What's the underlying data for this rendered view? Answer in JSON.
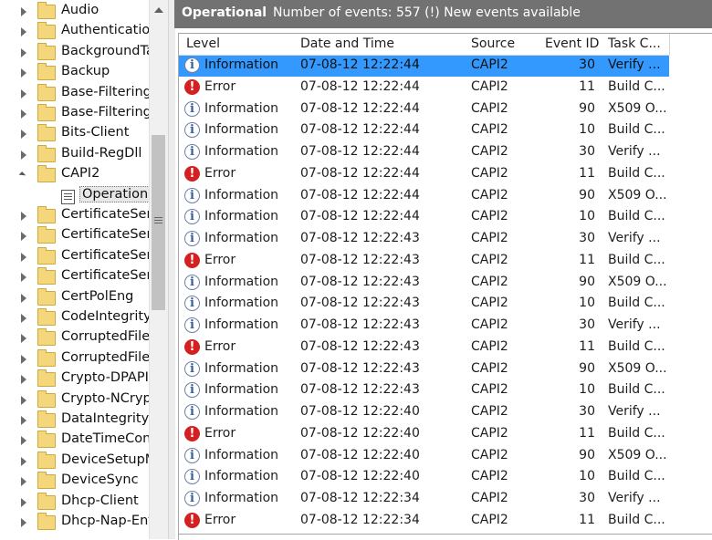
{
  "tree": {
    "items": [
      {
        "label": "Audio",
        "type": "folder"
      },
      {
        "label": "Authentication",
        "type": "folder"
      },
      {
        "label": "BackgroundTa",
        "type": "folder"
      },
      {
        "label": "Backup",
        "type": "folder"
      },
      {
        "label": "Base-Filtering-",
        "type": "folder"
      },
      {
        "label": "Base-Filtering-",
        "type": "folder"
      },
      {
        "label": "Bits-Client",
        "type": "folder"
      },
      {
        "label": "Build-RegDll",
        "type": "folder"
      },
      {
        "label": "CAPI2",
        "type": "folder",
        "expanded": true
      },
      {
        "label": "Operationa",
        "type": "log",
        "selected": true
      },
      {
        "label": "CertificateServ",
        "type": "folder"
      },
      {
        "label": "CertificateServ",
        "type": "folder"
      },
      {
        "label": "CertificateServ",
        "type": "folder"
      },
      {
        "label": "CertificateServ",
        "type": "folder"
      },
      {
        "label": "CertPolEng",
        "type": "folder"
      },
      {
        "label": "CodeIntegrity",
        "type": "folder"
      },
      {
        "label": "CorruptedFileR",
        "type": "folder"
      },
      {
        "label": "CorruptedFileF",
        "type": "folder"
      },
      {
        "label": "Crypto-DPAPI",
        "type": "folder"
      },
      {
        "label": "Crypto-NCrypt",
        "type": "folder"
      },
      {
        "label": "DataIntegritySc",
        "type": "folder"
      },
      {
        "label": "DateTimeCont",
        "type": "folder"
      },
      {
        "label": "DeviceSetupM",
        "type": "folder"
      },
      {
        "label": "DeviceSync",
        "type": "folder"
      },
      {
        "label": "Dhcp-Client",
        "type": "folder"
      },
      {
        "label": "Dhcp-Nap-Enf",
        "type": "folder"
      }
    ]
  },
  "header": {
    "title": "Operational",
    "count": "Number of events: 557 (!) New events available"
  },
  "grid": {
    "columns": [
      "Level",
      "Date and Time",
      "Source",
      "Event ID",
      "Task C..."
    ],
    "rows": [
      {
        "level": "Information",
        "date": "07-08-12 12:22:44",
        "source": "CAPI2",
        "id": "30",
        "task": "Verify ..."
      },
      {
        "level": "Error",
        "date": "07-08-12 12:22:44",
        "source": "CAPI2",
        "id": "11",
        "task": "Build C..."
      },
      {
        "level": "Information",
        "date": "07-08-12 12:22:44",
        "source": "CAPI2",
        "id": "90",
        "task": "X509 O..."
      },
      {
        "level": "Information",
        "date": "07-08-12 12:22:44",
        "source": "CAPI2",
        "id": "10",
        "task": "Build C..."
      },
      {
        "level": "Information",
        "date": "07-08-12 12:22:44",
        "source": "CAPI2",
        "id": "30",
        "task": "Verify ..."
      },
      {
        "level": "Error",
        "date": "07-08-12 12:22:44",
        "source": "CAPI2",
        "id": "11",
        "task": "Build C..."
      },
      {
        "level": "Information",
        "date": "07-08-12 12:22:44",
        "source": "CAPI2",
        "id": "90",
        "task": "X509 O..."
      },
      {
        "level": "Information",
        "date": "07-08-12 12:22:44",
        "source": "CAPI2",
        "id": "10",
        "task": "Build C..."
      },
      {
        "level": "Information",
        "date": "07-08-12 12:22:43",
        "source": "CAPI2",
        "id": "30",
        "task": "Verify ..."
      },
      {
        "level": "Error",
        "date": "07-08-12 12:22:43",
        "source": "CAPI2",
        "id": "11",
        "task": "Build C..."
      },
      {
        "level": "Information",
        "date": "07-08-12 12:22:43",
        "source": "CAPI2",
        "id": "90",
        "task": "X509 O..."
      },
      {
        "level": "Information",
        "date": "07-08-12 12:22:43",
        "source": "CAPI2",
        "id": "10",
        "task": "Build C..."
      },
      {
        "level": "Information",
        "date": "07-08-12 12:22:43",
        "source": "CAPI2",
        "id": "30",
        "task": "Verify ..."
      },
      {
        "level": "Error",
        "date": "07-08-12 12:22:43",
        "source": "CAPI2",
        "id": "11",
        "task": "Build C..."
      },
      {
        "level": "Information",
        "date": "07-08-12 12:22:43",
        "source": "CAPI2",
        "id": "90",
        "task": "X509 O..."
      },
      {
        "level": "Information",
        "date": "07-08-12 12:22:43",
        "source": "CAPI2",
        "id": "10",
        "task": "Build C..."
      },
      {
        "level": "Information",
        "date": "07-08-12 12:22:40",
        "source": "CAPI2",
        "id": "30",
        "task": "Verify ..."
      },
      {
        "level": "Error",
        "date": "07-08-12 12:22:40",
        "source": "CAPI2",
        "id": "11",
        "task": "Build C..."
      },
      {
        "level": "Information",
        "date": "07-08-12 12:22:40",
        "source": "CAPI2",
        "id": "90",
        "task": "X509 O..."
      },
      {
        "level": "Information",
        "date": "07-08-12 12:22:40",
        "source": "CAPI2",
        "id": "10",
        "task": "Build C..."
      },
      {
        "level": "Information",
        "date": "07-08-12 12:22:34",
        "source": "CAPI2",
        "id": "30",
        "task": "Verify ..."
      },
      {
        "level": "Error",
        "date": "07-08-12 12:22:34",
        "source": "CAPI2",
        "id": "11",
        "task": "Build C..."
      }
    ]
  },
  "colors": {
    "header_bg": "#727272",
    "selection": "#3399ff",
    "error": "#d42020"
  }
}
